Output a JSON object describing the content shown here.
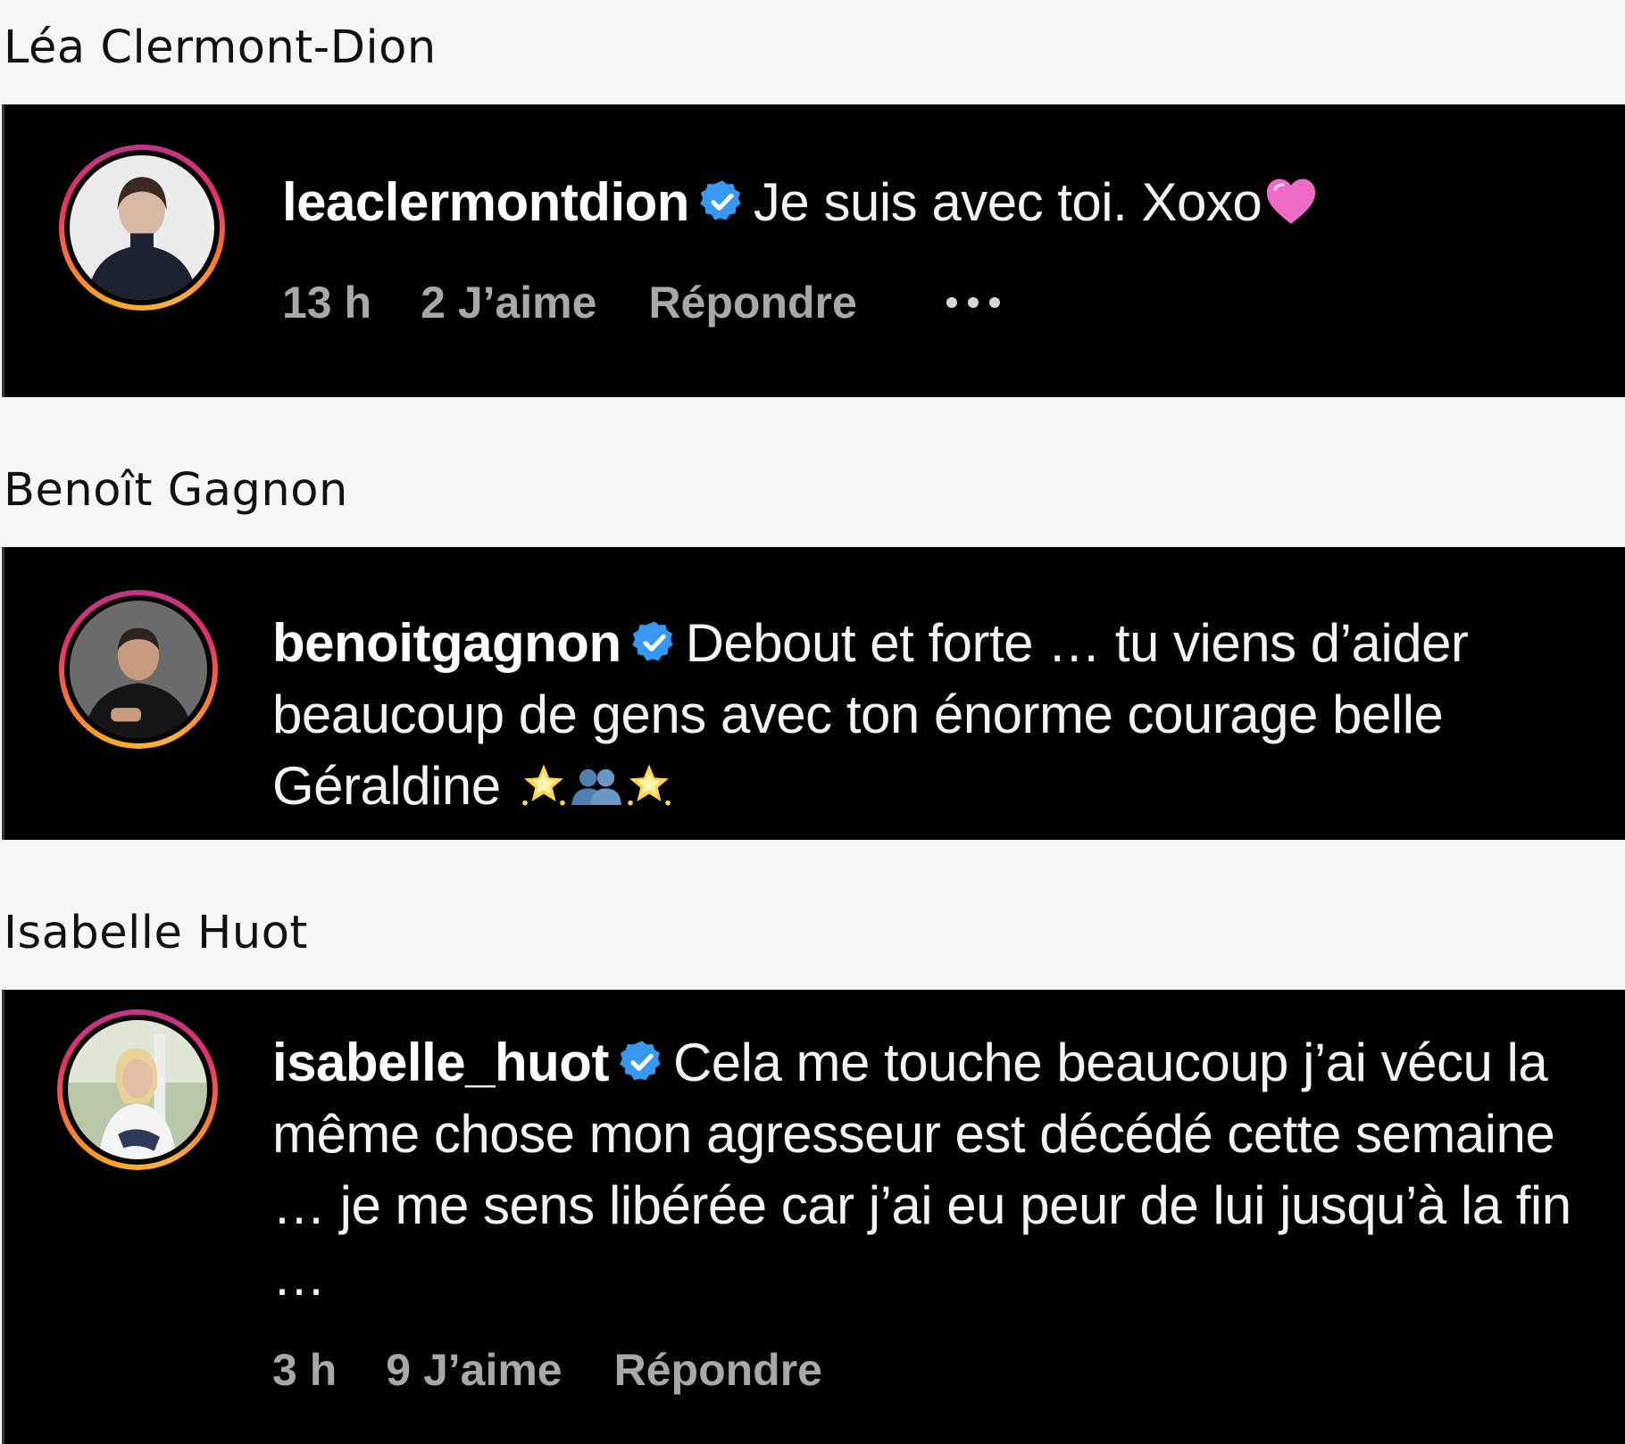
{
  "sections": [
    {
      "title": "Léa Clermont-Dion",
      "username": "leaclermontdion",
      "verified": true,
      "text": "Je suis avec toi. Xoxo",
      "emojis": [
        "pink-heart"
      ],
      "time": "13 h",
      "likes": "2 J’aime",
      "reply": "Répondre"
    },
    {
      "title": "Benoît Gagnon",
      "username": "benoitgagnon",
      "verified": true,
      "text": "Debout et forte … tu viens d’aider beaucoup de gens avec ton énorme courage belle Géraldine",
      "emojis": [
        "glowing-star",
        "two-people-silhouette",
        "glowing-star"
      ]
    },
    {
      "title": "Isabelle Huot",
      "username": "isabelle_huot",
      "verified": true,
      "text": "Cela me touche beaucoup j’ai vécu la même chose mon agresseur est décédé cette semaine … je me sens libérée car j’ai eu peur de lui jusqu’à la fin …",
      "time": "3 h",
      "likes": "9 J’aime",
      "reply": "Répondre"
    }
  ],
  "colors": {
    "page_background": "#f6f6f6",
    "panel_background": "#000000",
    "comment_text": "#f3f3f3",
    "meta_text": "#a8a8a8",
    "verified_badge": "#3897f0",
    "heart": "#f06bc8"
  }
}
